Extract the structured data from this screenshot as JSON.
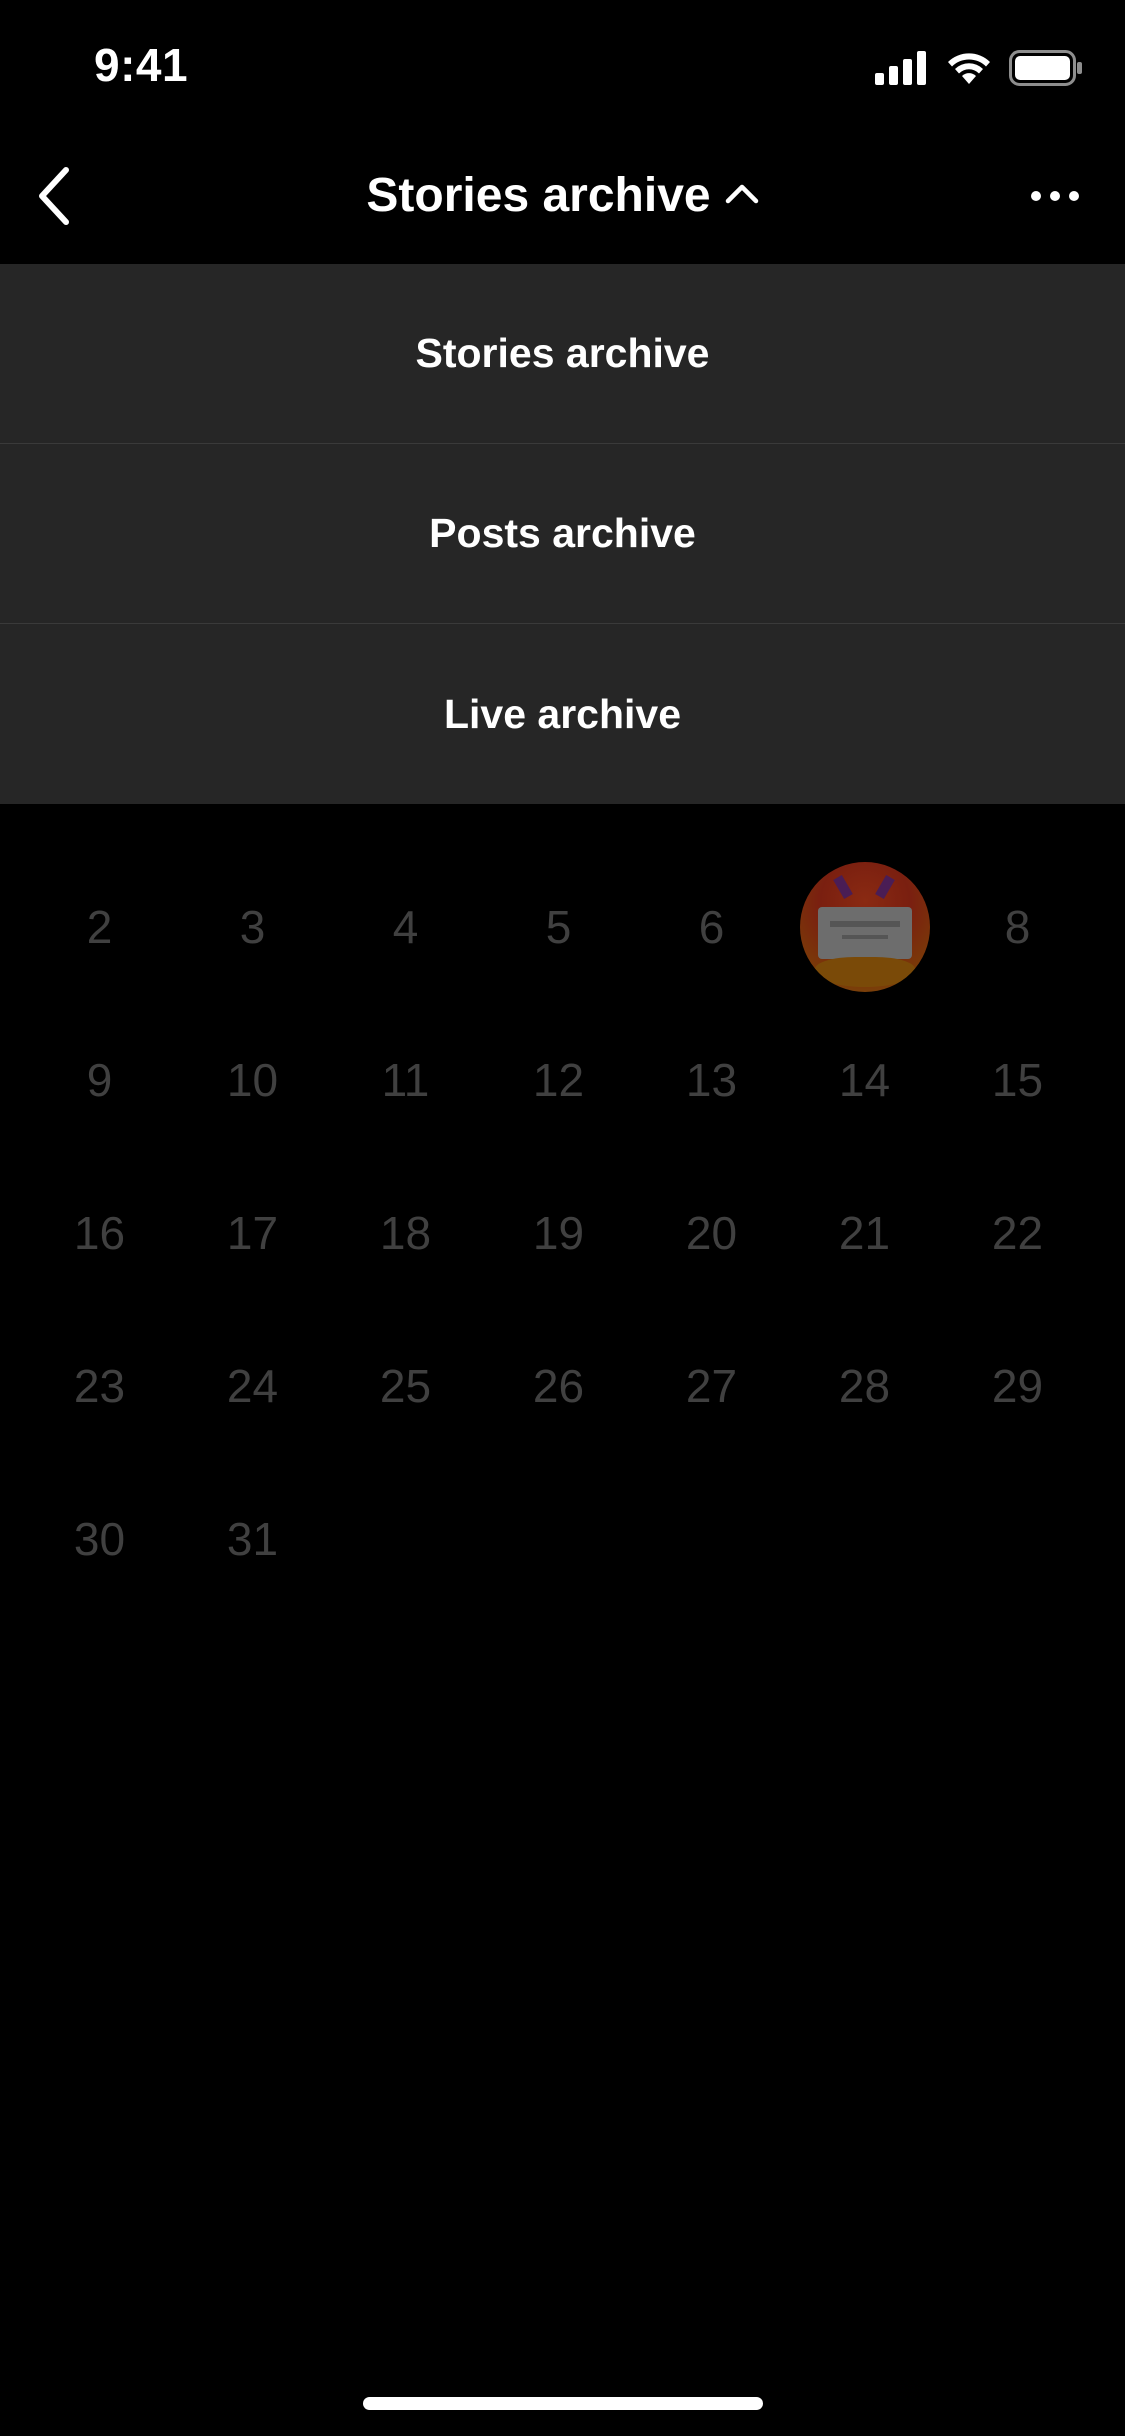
{
  "status_bar": {
    "time": "9:41",
    "icons": [
      "cellular-signal-icon",
      "wifi-icon",
      "battery-icon"
    ]
  },
  "nav": {
    "back_icon": "chevron-left-icon",
    "title": "Stories archive",
    "title_icon": "chevron-up-icon",
    "more_icon": "more-horizontal-icon"
  },
  "dropdown": {
    "items": [
      {
        "label": "Stories archive"
      },
      {
        "label": "Posts archive"
      },
      {
        "label": "Live archive"
      }
    ]
  },
  "calendar": {
    "days": [
      {
        "label": "2"
      },
      {
        "label": "3"
      },
      {
        "label": "4"
      },
      {
        "label": "5"
      },
      {
        "label": "6"
      },
      {
        "label": "",
        "has_story": true
      },
      {
        "label": "8"
      },
      {
        "label": "9"
      },
      {
        "label": "10"
      },
      {
        "label": "11"
      },
      {
        "label": "12"
      },
      {
        "label": "13"
      },
      {
        "label": "14"
      },
      {
        "label": "15"
      },
      {
        "label": "16"
      },
      {
        "label": "17"
      },
      {
        "label": "18"
      },
      {
        "label": "19"
      },
      {
        "label": "20"
      },
      {
        "label": "21"
      },
      {
        "label": "22"
      },
      {
        "label": "23"
      },
      {
        "label": "24"
      },
      {
        "label": "25"
      },
      {
        "label": "26"
      },
      {
        "label": "27"
      },
      {
        "label": "28"
      },
      {
        "label": "29"
      },
      {
        "label": "30"
      },
      {
        "label": "31"
      }
    ]
  },
  "colors": {
    "background": "#000000",
    "dropdown_background": "#262626",
    "dimmed_text": "#404040"
  }
}
